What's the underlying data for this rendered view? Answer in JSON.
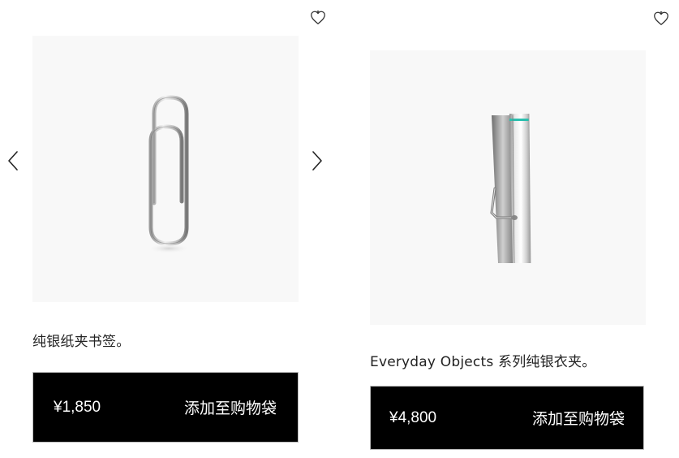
{
  "products": [
    {
      "name": "纯银纸夹书签。",
      "price": "¥1,850",
      "cart_label": "添加至购物袋",
      "wishlist_icon": "heart-outline-icon",
      "image": "silver-paperclip"
    },
    {
      "name": "Everyday Objects 系列纯银衣夹。",
      "price": "¥4,800",
      "cart_label": "添加至购物袋",
      "wishlist_icon": "heart-outline-icon",
      "image": "silver-clothespin",
      "accent_color": "#2cbfae"
    }
  ],
  "carousel": {
    "prev_icon": "chevron-left-icon",
    "next_icon": "chevron-right-icon"
  }
}
